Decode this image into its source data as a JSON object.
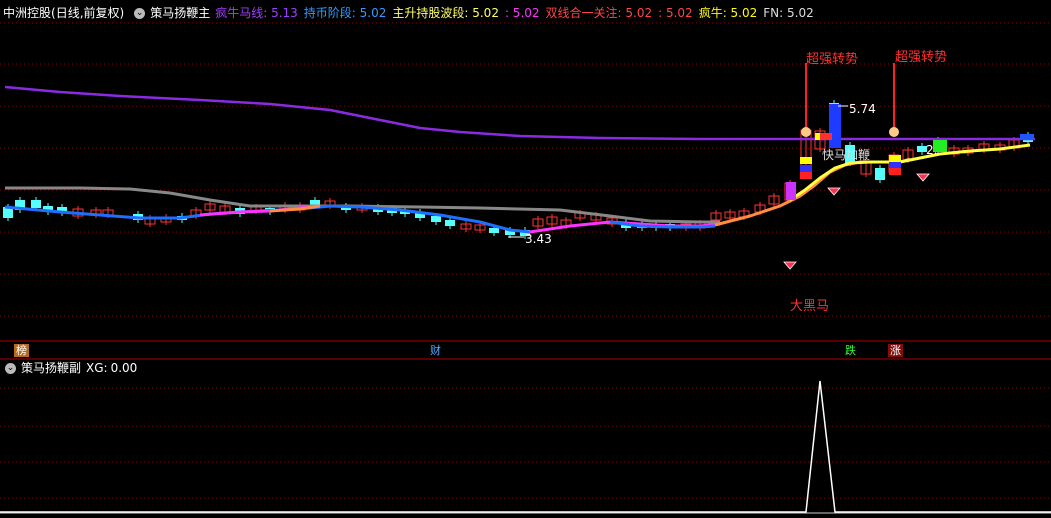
{
  "main_header": {
    "stock": "中洲控股",
    "period": "(日线,前复权)",
    "indicator": "策马扬鞭主",
    "items": [
      {
        "label": "疯牛马线:",
        "value": "5.13",
        "color": "#a040ff"
      },
      {
        "label": "持币阶段:",
        "value": "5.02",
        "color": "#3399ff"
      },
      {
        "label": "主升持股波段:",
        "value": "5.02",
        "color": "#ffff66"
      },
      {
        "label": ":",
        "value": "5.02",
        "color": "#ff33ff"
      },
      {
        "label": "双线合一关注:",
        "value": "5.02",
        "color": "#ff4444"
      },
      {
        "label": ":",
        "value": "5.02",
        "color": "#ff4444"
      },
      {
        "label": "疯牛:",
        "value": "5.02",
        "color": "#ffff00"
      },
      {
        "label": "FN:",
        "value": "5.02",
        "color": "#dddddd"
      }
    ]
  },
  "annotations": {
    "signal_left": "超强转势",
    "signal_right": "超强转势",
    "high_price": "5.74",
    "low_price": "3.43",
    "big_black_horse": "大黑马",
    "quick_whip": "快马加鞭",
    "right_value": "2."
  },
  "markers": {
    "bang": "榜",
    "cai": "财",
    "die": "跌",
    "zhang": "涨"
  },
  "sub_header": {
    "indicator": "策马扬鞭副",
    "label": "XG:",
    "value": "0.00"
  },
  "colors": {
    "background": "#000000",
    "grid": "#8b0000",
    "purple_line": "#8a2be2",
    "blue_line": "#1e6fff",
    "gray_line": "#888888",
    "magenta_line": "#ff33ff",
    "yellow_line": "#ffff44",
    "orange_line": "#ff8c40",
    "up_candle": "#ff3333",
    "down_candle": "#55ffff"
  }
}
